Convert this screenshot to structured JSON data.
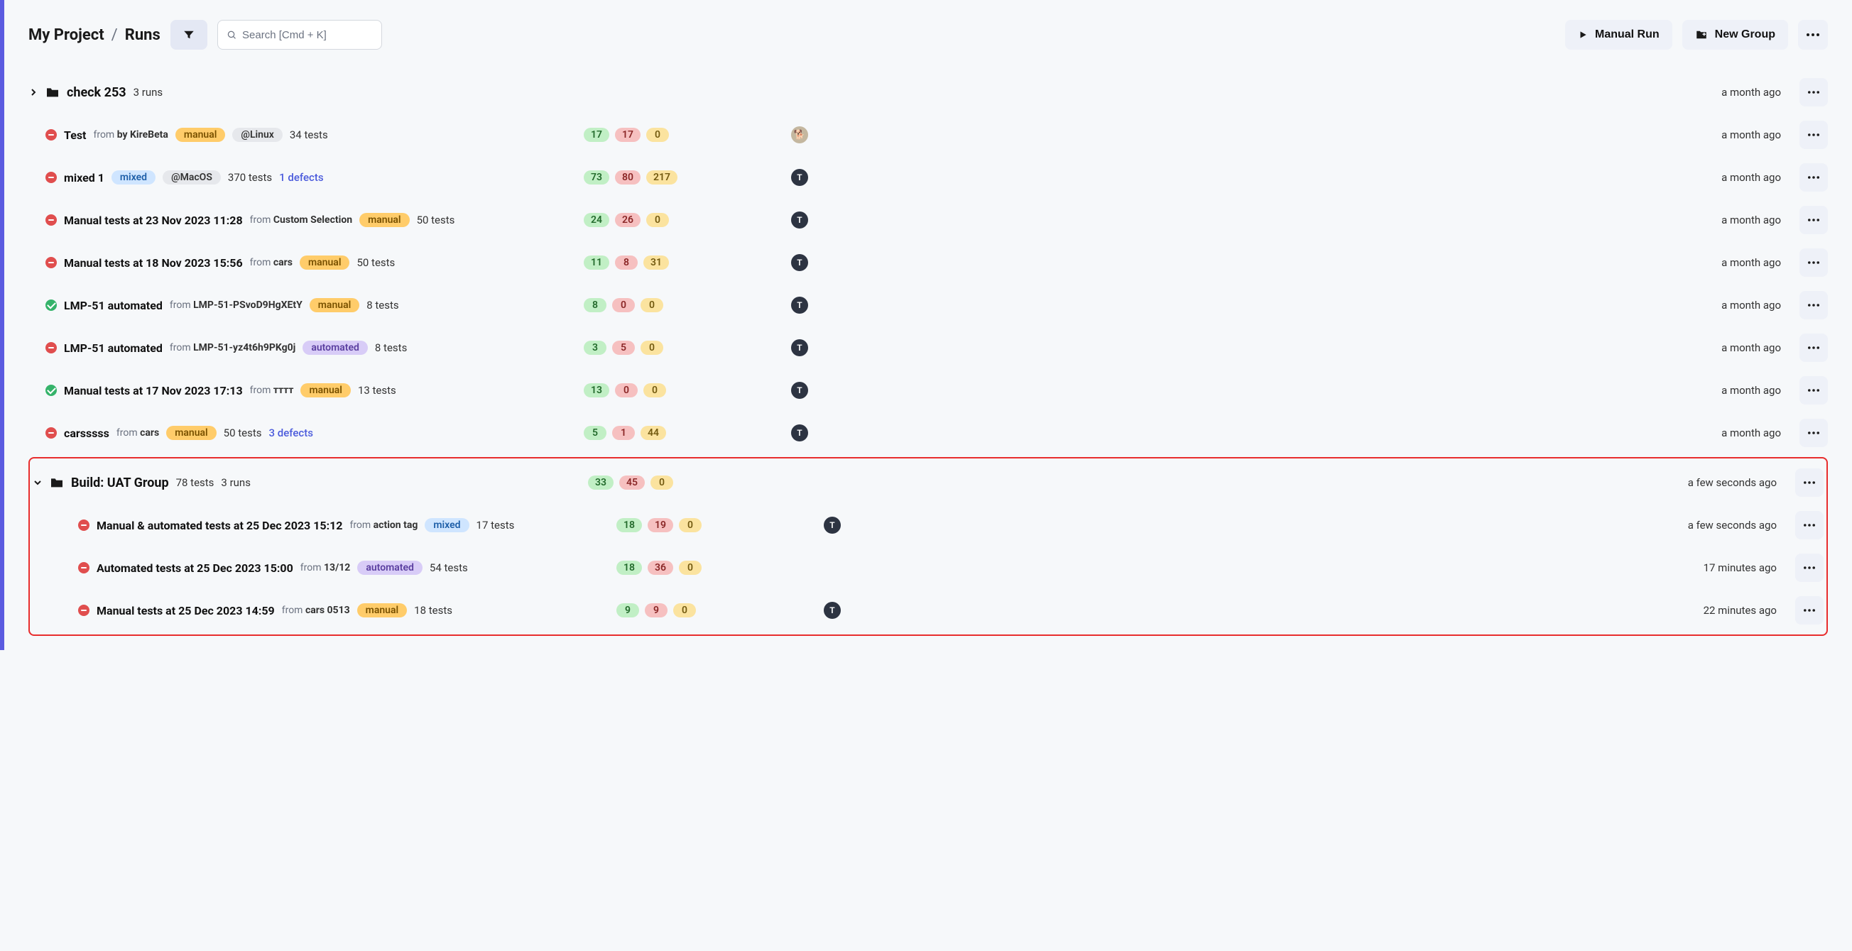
{
  "breadcrumb": {
    "project": "My Project",
    "section": "Runs"
  },
  "search": {
    "placeholder": "Search [Cmd + K]"
  },
  "buttons": {
    "manual_run": "Manual Run",
    "new_group": "New Group"
  },
  "groups": [
    {
      "id": "check253",
      "expanded": false,
      "title": "check 253",
      "tests_label": "3 runs",
      "time": "a month ago"
    }
  ],
  "runs": [
    {
      "status": "red",
      "title": "Test",
      "from": "by KireBeta",
      "type": "manual",
      "tag": "@Linux",
      "tests": "34 tests",
      "defects": "",
      "pills": {
        "g": "17",
        "r": "17",
        "y": "0"
      },
      "avatar": "img",
      "time": "a month ago"
    },
    {
      "status": "red",
      "title": "mixed 1",
      "from": "",
      "type": "mixed",
      "tag": "@MacOS",
      "tests": "370 tests",
      "defects": "1 defects",
      "pills": {
        "g": "73",
        "r": "80",
        "y": "217"
      },
      "avatar": "T",
      "time": "a month ago"
    },
    {
      "status": "red",
      "title": "Manual tests at 23 Nov 2023 11:28",
      "from": "Custom Selection",
      "type": "manual",
      "tag": "",
      "tests": "50 tests",
      "defects": "",
      "pills": {
        "g": "24",
        "r": "26",
        "y": "0"
      },
      "avatar": "T",
      "time": "a month ago"
    },
    {
      "status": "red",
      "title": "Manual tests at 18 Nov 2023 15:56",
      "from": "cars",
      "type": "manual",
      "tag": "",
      "tests": "50 tests",
      "defects": "",
      "pills": {
        "g": "11",
        "r": "8",
        "y": "31"
      },
      "avatar": "T",
      "time": "a month ago"
    },
    {
      "status": "green",
      "title": "LMP-51 automated",
      "from": "LMP-51-PSvoD9HgXEtY",
      "type": "manual",
      "tag": "",
      "tests": "8 tests",
      "defects": "",
      "pills": {
        "g": "8",
        "r": "0",
        "y": "0"
      },
      "avatar": "T",
      "time": "a month ago"
    },
    {
      "status": "red",
      "title": "LMP-51 automated",
      "from": "LMP-51-yz4t6h9PKg0j",
      "type": "automated",
      "tag": "",
      "tests": "8 tests",
      "defects": "",
      "pills": {
        "g": "3",
        "r": "5",
        "y": "0"
      },
      "avatar": "T",
      "time": "a month ago"
    },
    {
      "status": "green",
      "title": "Manual tests at 17 Nov 2023 17:13",
      "from": "тттт",
      "type": "manual",
      "tag": "",
      "tests": "13 tests",
      "defects": "",
      "pills": {
        "g": "13",
        "r": "0",
        "y": "0"
      },
      "avatar": "T",
      "time": "a month ago"
    },
    {
      "status": "red",
      "title": "carsssss",
      "from": "cars",
      "type": "manual",
      "tag": "",
      "tests": "50 tests",
      "defects": "3 defects",
      "pills": {
        "g": "5",
        "r": "1",
        "y": "44"
      },
      "avatar": "T",
      "time": "a month ago"
    }
  ],
  "red_group": {
    "header": {
      "title": "Build: UAT Group",
      "tests": "78 tests",
      "runs": "3 runs",
      "pills": {
        "g": "33",
        "r": "45",
        "y": "0"
      },
      "time": "a few seconds ago"
    },
    "children": [
      {
        "status": "red",
        "title": "Manual & automated tests at 25 Dec 2023 15:12",
        "from": "action tag",
        "type": "mixed",
        "tests": "17 tests",
        "pills": {
          "g": "18",
          "r": "19",
          "y": "0"
        },
        "avatar": "T",
        "time": "a few seconds ago"
      },
      {
        "status": "red",
        "title": "Automated tests at 25 Dec 2023 15:00",
        "from": "13/12",
        "type": "automated",
        "tests": "54 tests",
        "pills": {
          "g": "18",
          "r": "36",
          "y": "0"
        },
        "avatar": "",
        "time": "17 minutes ago"
      },
      {
        "status": "red",
        "title": "Manual tests at 25 Dec 2023 14:59",
        "from": "cars 0513",
        "type": "manual",
        "tests": "18 tests",
        "pills": {
          "g": "9",
          "r": "9",
          "y": "0"
        },
        "avatar": "T",
        "time": "22 minutes ago"
      }
    ]
  },
  "labels": {
    "from": "from"
  }
}
